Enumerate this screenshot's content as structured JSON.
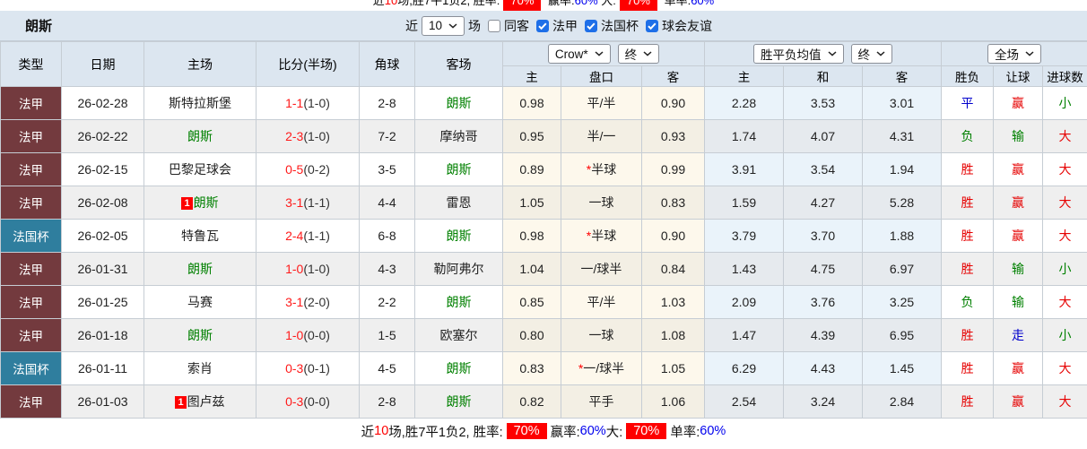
{
  "title": "朗斯",
  "controls": {
    "recent_label": "近",
    "matches_value": "10",
    "matches_label": "场",
    "checkbox_color": "#1e6fe8",
    "checkboxes": [
      {
        "label": "同客",
        "checked": false
      },
      {
        "label": "法甲",
        "checked": true
      },
      {
        "label": "法国杯",
        "checked": true
      },
      {
        "label": "球会友谊",
        "checked": true
      }
    ]
  },
  "header": {
    "left_columns": [
      "类型",
      "日期",
      "主场",
      "比分(半场)",
      "角球",
      "客场"
    ],
    "asian_selects": [
      "Crow*",
      "终"
    ],
    "euro_selects": [
      "胜平负均值",
      "终"
    ],
    "scope_selects": [
      "全场"
    ],
    "sub_columns": [
      "主",
      "盘口",
      "客",
      "主",
      "和",
      "客",
      "胜负",
      "让球",
      "进球数"
    ]
  },
  "colors": {
    "type_bg": {
      "法甲": "#733a3e",
      "法国杯": "#2f7e9e"
    },
    "team_green": "#008000",
    "score_red": "#ff1a1a",
    "half_time": "#333333",
    "red": "#e60000",
    "green": "#008000",
    "blue": "#0000cc",
    "badge_bg": "#fe0000",
    "blue_pct": "#0000ee",
    "star_red": "#ff0000"
  },
  "badge_text": "1",
  "rows": [
    {
      "type": "法甲",
      "date": "26-02-28",
      "home": "斯特拉斯堡",
      "home_green": false,
      "home_badge": false,
      "score": "1-1",
      "half": "(1-0)",
      "corner": "2-8",
      "away": "朗斯",
      "away_green": true,
      "odds_home": "0.98",
      "handicap": "平/半",
      "handicap_star": false,
      "odds_away": "0.90",
      "eu_home": "2.28",
      "eu_draw": "3.53",
      "eu_away": "3.01",
      "wdl": "平",
      "wdl_color": "blue",
      "hc": "赢",
      "hc_color": "red",
      "goals": "小",
      "goals_color": "green"
    },
    {
      "type": "法甲",
      "date": "26-02-22",
      "home": "朗斯",
      "home_green": true,
      "home_badge": false,
      "score": "2-3",
      "half": "(1-0)",
      "corner": "7-2",
      "away": "摩纳哥",
      "away_green": false,
      "odds_home": "0.95",
      "handicap": "半/一",
      "handicap_star": false,
      "odds_away": "0.93",
      "eu_home": "1.74",
      "eu_draw": "4.07",
      "eu_away": "4.31",
      "wdl": "负",
      "wdl_color": "green",
      "hc": "输",
      "hc_color": "green",
      "goals": "大",
      "goals_color": "red"
    },
    {
      "type": "法甲",
      "date": "26-02-15",
      "home": "巴黎足球会",
      "home_green": false,
      "home_badge": false,
      "score": "0-5",
      "half": "(0-2)",
      "corner": "3-5",
      "away": "朗斯",
      "away_green": true,
      "odds_home": "0.89",
      "handicap": "半球",
      "handicap_star": true,
      "odds_away": "0.99",
      "eu_home": "3.91",
      "eu_draw": "3.54",
      "eu_away": "1.94",
      "wdl": "胜",
      "wdl_color": "red",
      "hc": "赢",
      "hc_color": "red",
      "goals": "大",
      "goals_color": "red"
    },
    {
      "type": "法甲",
      "date": "26-02-08",
      "home": "朗斯",
      "home_green": true,
      "home_badge": true,
      "score": "3-1",
      "half": "(1-1)",
      "corner": "4-4",
      "away": "雷恩",
      "away_green": false,
      "odds_home": "1.05",
      "handicap": "一球",
      "handicap_star": false,
      "odds_away": "0.83",
      "eu_home": "1.59",
      "eu_draw": "4.27",
      "eu_away": "5.28",
      "wdl": "胜",
      "wdl_color": "red",
      "hc": "赢",
      "hc_color": "red",
      "goals": "大",
      "goals_color": "red"
    },
    {
      "type": "法国杯",
      "date": "26-02-05",
      "home": "特鲁瓦",
      "home_green": false,
      "home_badge": false,
      "score": "2-4",
      "half": "(1-1)",
      "corner": "6-8",
      "away": "朗斯",
      "away_green": true,
      "odds_home": "0.98",
      "handicap": "半球",
      "handicap_star": true,
      "odds_away": "0.90",
      "eu_home": "3.79",
      "eu_draw": "3.70",
      "eu_away": "1.88",
      "wdl": "胜",
      "wdl_color": "red",
      "hc": "赢",
      "hc_color": "red",
      "goals": "大",
      "goals_color": "red"
    },
    {
      "type": "法甲",
      "date": "26-01-31",
      "home": "朗斯",
      "home_green": true,
      "home_badge": false,
      "score": "1-0",
      "half": "(1-0)",
      "corner": "4-3",
      "away": "勒阿弗尔",
      "away_green": false,
      "odds_home": "1.04",
      "handicap": "一/球半",
      "handicap_star": false,
      "odds_away": "0.84",
      "eu_home": "1.43",
      "eu_draw": "4.75",
      "eu_away": "6.97",
      "wdl": "胜",
      "wdl_color": "red",
      "hc": "输",
      "hc_color": "green",
      "goals": "小",
      "goals_color": "green"
    },
    {
      "type": "法甲",
      "date": "26-01-25",
      "home": "马赛",
      "home_green": false,
      "home_badge": false,
      "score": "3-1",
      "half": "(2-0)",
      "corner": "2-2",
      "away": "朗斯",
      "away_green": true,
      "odds_home": "0.85",
      "handicap": "平/半",
      "handicap_star": false,
      "odds_away": "1.03",
      "eu_home": "2.09",
      "eu_draw": "3.76",
      "eu_away": "3.25",
      "wdl": "负",
      "wdl_color": "green",
      "hc": "输",
      "hc_color": "green",
      "goals": "大",
      "goals_color": "red"
    },
    {
      "type": "法甲",
      "date": "26-01-18",
      "home": "朗斯",
      "home_green": true,
      "home_badge": false,
      "score": "1-0",
      "half": "(0-0)",
      "corner": "1-5",
      "away": "欧塞尔",
      "away_green": false,
      "odds_home": "0.80",
      "handicap": "一球",
      "handicap_star": false,
      "odds_away": "1.08",
      "eu_home": "1.47",
      "eu_draw": "4.39",
      "eu_away": "6.95",
      "wdl": "胜",
      "wdl_color": "red",
      "hc": "走",
      "hc_color": "blue",
      "goals": "小",
      "goals_color": "green"
    },
    {
      "type": "法国杯",
      "date": "26-01-11",
      "home": "索肖",
      "home_green": false,
      "home_badge": false,
      "score": "0-3",
      "half": "(0-1)",
      "corner": "4-5",
      "away": "朗斯",
      "away_green": true,
      "odds_home": "0.83",
      "handicap": "一/球半",
      "handicap_star": true,
      "odds_away": "1.05",
      "eu_home": "6.29",
      "eu_draw": "4.43",
      "eu_away": "1.45",
      "wdl": "胜",
      "wdl_color": "red",
      "hc": "赢",
      "hc_color": "red",
      "goals": "大",
      "goals_color": "red"
    },
    {
      "type": "法甲",
      "date": "26-01-03",
      "home": "图卢兹",
      "home_green": false,
      "home_badge": true,
      "score": "0-3",
      "half": "(0-0)",
      "corner": "2-8",
      "away": "朗斯",
      "away_green": true,
      "odds_home": "0.82",
      "handicap": "平手",
      "handicap_star": false,
      "odds_away": "1.06",
      "eu_home": "2.54",
      "eu_draw": "3.24",
      "eu_away": "2.84",
      "wdl": "胜",
      "wdl_color": "red",
      "hc": "赢",
      "hc_color": "red",
      "goals": "大",
      "goals_color": "red"
    }
  ],
  "footer_parts": [
    {
      "text": "近",
      "style": "black"
    },
    {
      "text": "10",
      "style": "red"
    },
    {
      "text": "场,胜7平1负2, 胜率:",
      "style": "black"
    },
    {
      "text": "70%",
      "style": "badge"
    },
    {
      "text": " 赢率:",
      "style": "black"
    },
    {
      "text": "60%",
      "style": "bluepct"
    },
    {
      "text": " 大:",
      "style": "black"
    },
    {
      "text": "70%",
      "style": "badge"
    },
    {
      "text": " 单率:",
      "style": "black"
    },
    {
      "text": "60%",
      "style": "bluepct"
    }
  ]
}
